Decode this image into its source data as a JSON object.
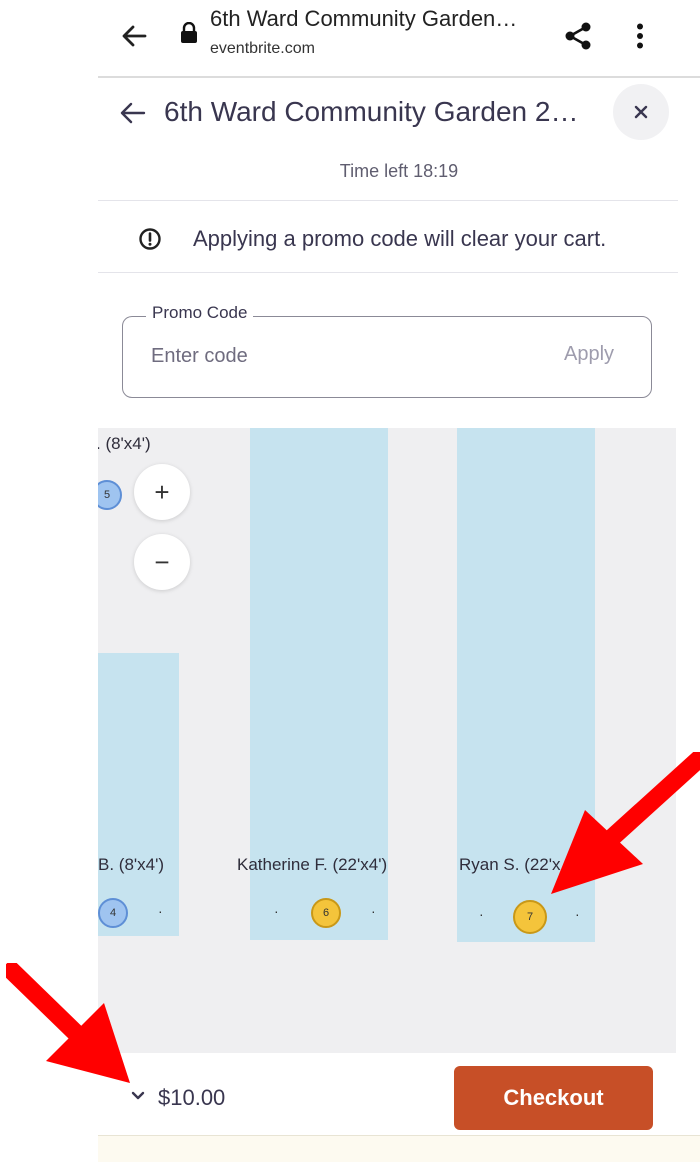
{
  "browser": {
    "page_title": "6th Ward Community Garden…",
    "domain": "eventbrite.com"
  },
  "ticket": {
    "title": "6th Ward Community Garden 2…",
    "time_left": "Time left 18:19",
    "notice": "Applying a promo code will clear your cart."
  },
  "promo": {
    "label": "Promo Code",
    "placeholder": "Enter code",
    "apply_label": "Apply"
  },
  "map": {
    "plots": [
      {
        "label": ". (8'x4')",
        "seat": "5"
      },
      {
        "label": "B. (8'x4')",
        "seat": "4"
      },
      {
        "label": "Katherine F. (22'x4')",
        "seat": "6"
      },
      {
        "label": "Ryan S. (22'x",
        "seat": "7"
      }
    ],
    "zoom_in": "+",
    "zoom_out": "−"
  },
  "footer": {
    "total": "$10.00",
    "checkout_label": "Checkout"
  },
  "colors": {
    "checkout": "#c74f27",
    "plot_fill": "#c6e3ef",
    "seat_selected": "#f4c43b",
    "seat_available": "#9fc4f0",
    "annotation_arrow": "#ff0000"
  }
}
